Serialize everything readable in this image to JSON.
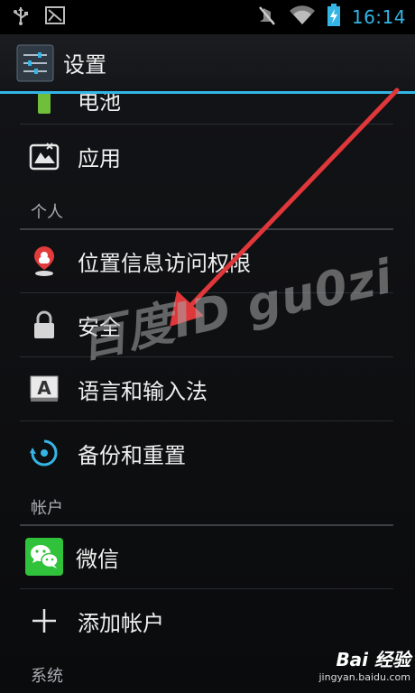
{
  "status_bar": {
    "time": "16:14",
    "left_icons": [
      "usb-icon",
      "debug-icon"
    ],
    "right_icons": [
      "mute-icon",
      "wifi-icon",
      "battery-charging-icon"
    ]
  },
  "action_bar": {
    "title": "设置",
    "icon": "settings-sliders-icon"
  },
  "list": {
    "partial_item": {
      "label": "电池",
      "icon": "battery-icon"
    },
    "items_top": [
      {
        "label": "应用",
        "icon": "apps-icon"
      }
    ],
    "sections": [
      {
        "header": "个人",
        "items": [
          {
            "label": "位置信息访问权限",
            "icon": "location-icon"
          },
          {
            "label": "安全",
            "icon": "lock-icon"
          },
          {
            "label": "语言和输入法",
            "icon": "keyboard-a-icon"
          },
          {
            "label": "备份和重置",
            "icon": "backup-icon"
          }
        ]
      },
      {
        "header": "帐户",
        "items": [
          {
            "label": "微信",
            "icon": "wechat-icon"
          },
          {
            "label": "添加帐户",
            "icon": "plus-icon"
          }
        ]
      },
      {
        "header": "系统",
        "items": []
      }
    ]
  },
  "overlay": {
    "watermark": "百度ID gu0zi",
    "brand_name": "Bai  经验",
    "brand_url": "jingyan.baidu.com"
  },
  "colors": {
    "accent": "#33b5e5",
    "arrow": "#e0373a",
    "wechat": "#2fc23a"
  }
}
